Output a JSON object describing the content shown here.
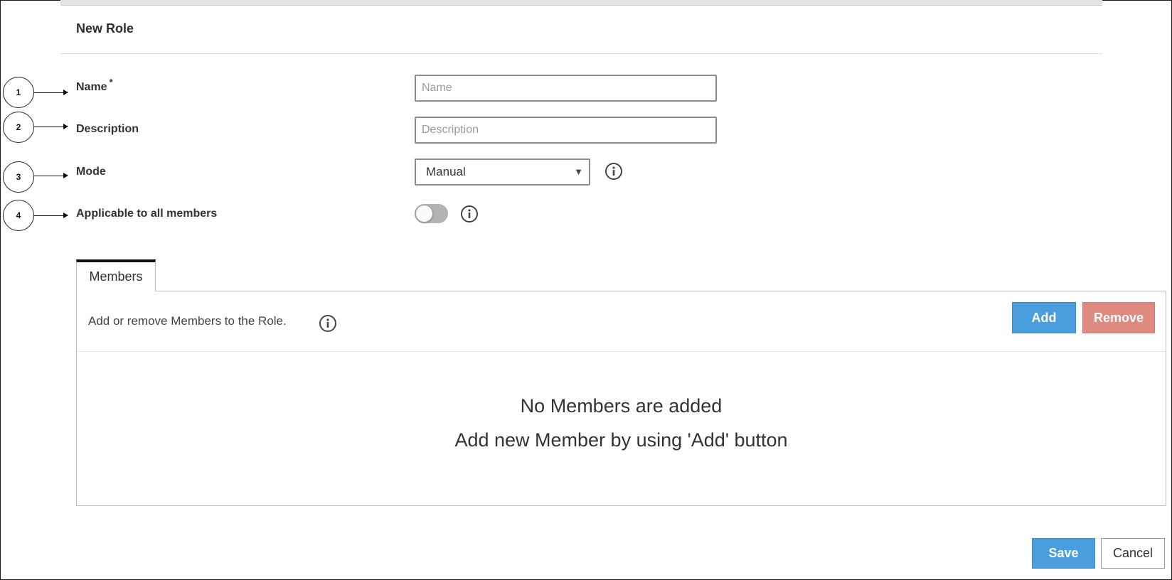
{
  "header": {
    "title": "New Role"
  },
  "callouts": [
    "1",
    "2",
    "3",
    "4"
  ],
  "form": {
    "name": {
      "label": "Name",
      "required_mark": "*",
      "placeholder": "Name",
      "value": ""
    },
    "description": {
      "label": "Description",
      "placeholder": "Description",
      "value": ""
    },
    "mode": {
      "label": "Mode",
      "selected": "Manual",
      "caret": "▼"
    },
    "applicable": {
      "label": "Applicable to all members",
      "enabled": false
    }
  },
  "members_tab": {
    "label": "Members",
    "description": "Add or remove Members to the Role.",
    "add_label": "Add",
    "remove_label": "Remove",
    "empty_title": "No Members are added",
    "empty_subtitle": "Add new Member by using 'Add' button"
  },
  "footer": {
    "save_label": "Save",
    "cancel_label": "Cancel"
  },
  "icons": {
    "info": "info-circle-icon"
  },
  "colors": {
    "primary": "#4a9ede",
    "danger": "#df8a7e",
    "toggle_off": "#b3b3b3"
  }
}
